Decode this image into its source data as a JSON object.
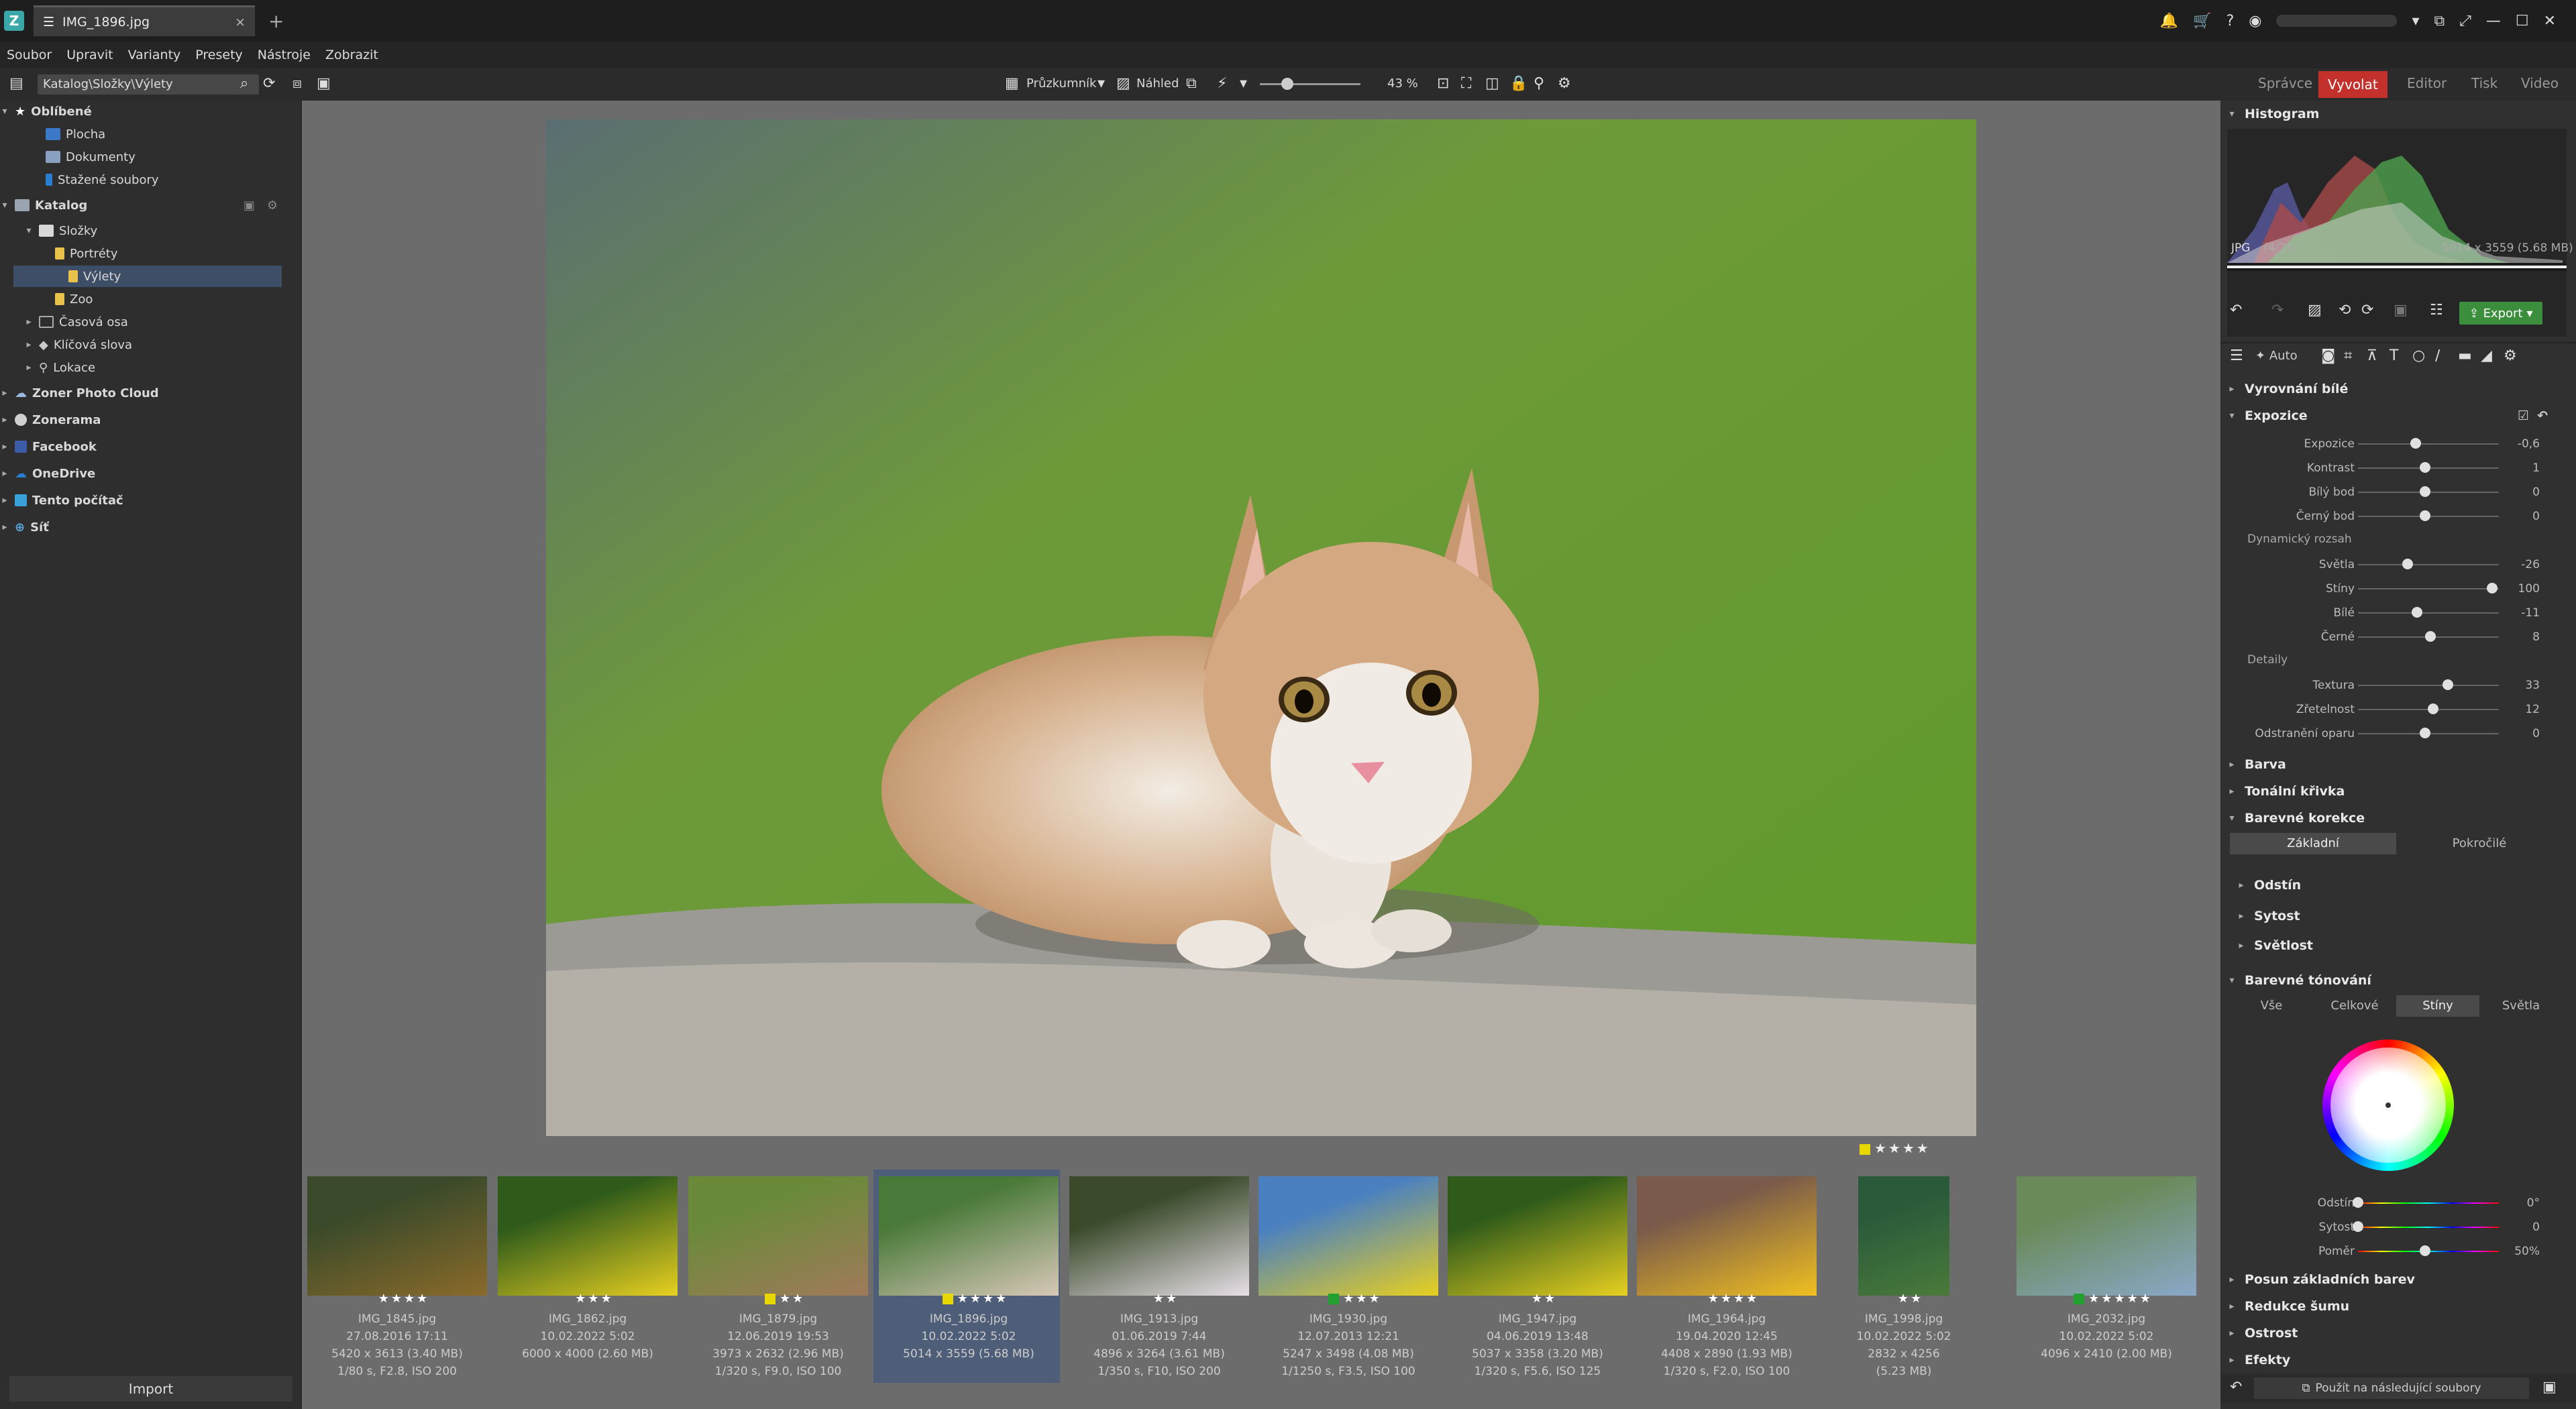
{
  "titlebar": {
    "app_icon": "Z",
    "tab_title": "IMG_1896.jpg",
    "tab_close": "×",
    "new_tab": "+",
    "icons": [
      "bell-icon",
      "cart-icon",
      "help-icon",
      "user-icon",
      "shrink-icon",
      "expand-icon",
      "minimize-icon",
      "maximize-icon",
      "close-icon"
    ]
  },
  "menu": {
    "items": [
      "Soubor",
      "Upravit",
      "Varianty",
      "Presety",
      "Nástroje",
      "Zobrazit"
    ]
  },
  "toolbar": {
    "address": "Katalog\\Složky\\Výlety",
    "explorer_label": "Průzkumník",
    "preview_label": "Náhled",
    "zoom": "43 %",
    "modules": [
      "Správce",
      "Vyvolat",
      "Editor",
      "Tisk",
      "Video"
    ],
    "active_module": "Vyvolat"
  },
  "left": {
    "favorites": "Oblíbené",
    "fav_items": [
      "Plocha",
      "Dokumenty",
      "Stažené soubory"
    ],
    "catalog": "Katalog",
    "folders": "Složky",
    "folder_items": [
      "Portréty",
      "Výlety",
      "Zoo"
    ],
    "catalog_items": [
      "Časová osa",
      "Klíčová slova",
      "Lokace"
    ],
    "roots": [
      "Zoner Photo Cloud",
      "Zonerama",
      "Facebook",
      "OneDrive",
      "Tento počítač",
      "Síť"
    ],
    "import_label": "Import"
  },
  "viewer": {
    "rating": "★★★★"
  },
  "filmstrip": [
    {
      "name": "IMG_1845.jpg",
      "date": "27.08.2016 17:11",
      "size": "5420 x 3613 (3.40 MB)",
      "exif": "1/80 s, F2.8, ISO 200",
      "stars": "★★★★",
      "flag": ""
    },
    {
      "name": "IMG_1862.jpg",
      "date": "10.02.2022 5:02",
      "size": "6000 x 4000 (2.60 MB)",
      "exif": "",
      "stars": "★★★",
      "flag": ""
    },
    {
      "name": "IMG_1879.jpg",
      "date": "12.06.2019 19:53",
      "size": "3973 x 2632 (2.96 MB)",
      "exif": "1/320 s, F9.0, ISO 100",
      "stars": "★★",
      "flag": "#e8d800"
    },
    {
      "name": "IMG_1896.jpg",
      "date": "10.02.2022 5:02",
      "size": "5014 x 3559 (5.68 MB)",
      "exif": "",
      "stars": "★★★★",
      "flag": "#e8d800"
    },
    {
      "name": "IMG_1913.jpg",
      "date": "01.06.2019 7:44",
      "size": "4896 x 3264 (3.61 MB)",
      "exif": "1/350 s, F10, ISO 200",
      "stars": "★★",
      "flag": ""
    },
    {
      "name": "IMG_1930.jpg",
      "date": "12.07.2013 12:21",
      "size": "5247 x 3498 (4.08 MB)",
      "exif": "1/1250 s, F3.5, ISO 100",
      "stars": "★★★",
      "flag": "#22a030"
    },
    {
      "name": "IMG_1947.jpg",
      "date": "04.06.2019 13:48",
      "size": "5037 x 3358 (3.20 MB)",
      "exif": "1/320 s, F5.6, ISO 125",
      "stars": "★★",
      "flag": ""
    },
    {
      "name": "IMG_1964.jpg",
      "date": "19.04.2020 12:45",
      "size": "4408 x 2890 (1.93 MB)",
      "exif": "1/320 s, F2.0, ISO 100",
      "stars": "★★★★",
      "flag": ""
    },
    {
      "name": "IMG_1998.jpg",
      "date": "10.02.2022 5:02",
      "size": "2832 x 4256 (5.23 MB)",
      "exif": "",
      "stars": "★★",
      "flag": ""
    },
    {
      "name": "IMG_2032.jpg",
      "date": "10.02.2022 5:02",
      "size": "4096 x 2410 (2.00 MB)",
      "exif": "",
      "stars": "★★★★★",
      "flag": "#22a030"
    }
  ],
  "right": {
    "histogram_title": "Histogram",
    "file_type": "JPG",
    "file_index": "(4/26)",
    "file_dims": "5014 x 3559 (5.68 MB)",
    "export_label": "Export",
    "auto_label": "Auto",
    "sections_top": [
      "Vyrovnání bílé",
      "Expozice"
    ],
    "exposure_sliders": [
      {
        "label": "Expozice",
        "value": "-0,6",
        "pos": 0.43
      },
      {
        "label": "Kontrast",
        "value": "1",
        "pos": 0.5
      },
      {
        "label": "Bílý bod",
        "value": "0",
        "pos": 0.5
      },
      {
        "label": "Černý bod",
        "value": "0",
        "pos": 0.5
      }
    ],
    "dynamic_range": "Dynamický rozsah",
    "dr_sliders": [
      {
        "label": "Světla",
        "value": "-26",
        "pos": 0.37
      },
      {
        "label": "Stíny",
        "value": "100",
        "pos": 1.0
      },
      {
        "label": "Bílé",
        "value": "-11",
        "pos": 0.44
      },
      {
        "label": "Černé",
        "value": "8",
        "pos": 0.54
      }
    ],
    "details": "Detaily",
    "detail_sliders": [
      {
        "label": "Textura",
        "value": "33",
        "pos": 0.67
      },
      {
        "label": "Zřetelnost",
        "value": "12",
        "pos": 0.56
      },
      {
        "label": "Odstranění oparu",
        "value": "0",
        "pos": 0.5
      }
    ],
    "sections_mid": [
      "Barva",
      "Tonální křivka",
      "Barevné korekce"
    ],
    "corr_tabs": [
      "Základní",
      "Pokročilé"
    ],
    "corr_items": [
      "Odstín",
      "Sytost",
      "Světlost"
    ],
    "toning": "Barevné tónování",
    "toning_tabs": [
      "Vše",
      "Celkové",
      "Stíny",
      "Světla"
    ],
    "toning_sliders": [
      {
        "label": "Odstín",
        "value": "0°",
        "pos": 0.0
      },
      {
        "label": "Sytost",
        "value": "0",
        "pos": 0.0
      },
      {
        "label": "Poměr",
        "value": "50%",
        "pos": 0.5
      }
    ],
    "sections_bottom": [
      "Posun základních barev",
      "Redukce šumu",
      "Ostrost",
      "Efekty"
    ],
    "apply_label": "Použít na následující soubory"
  }
}
